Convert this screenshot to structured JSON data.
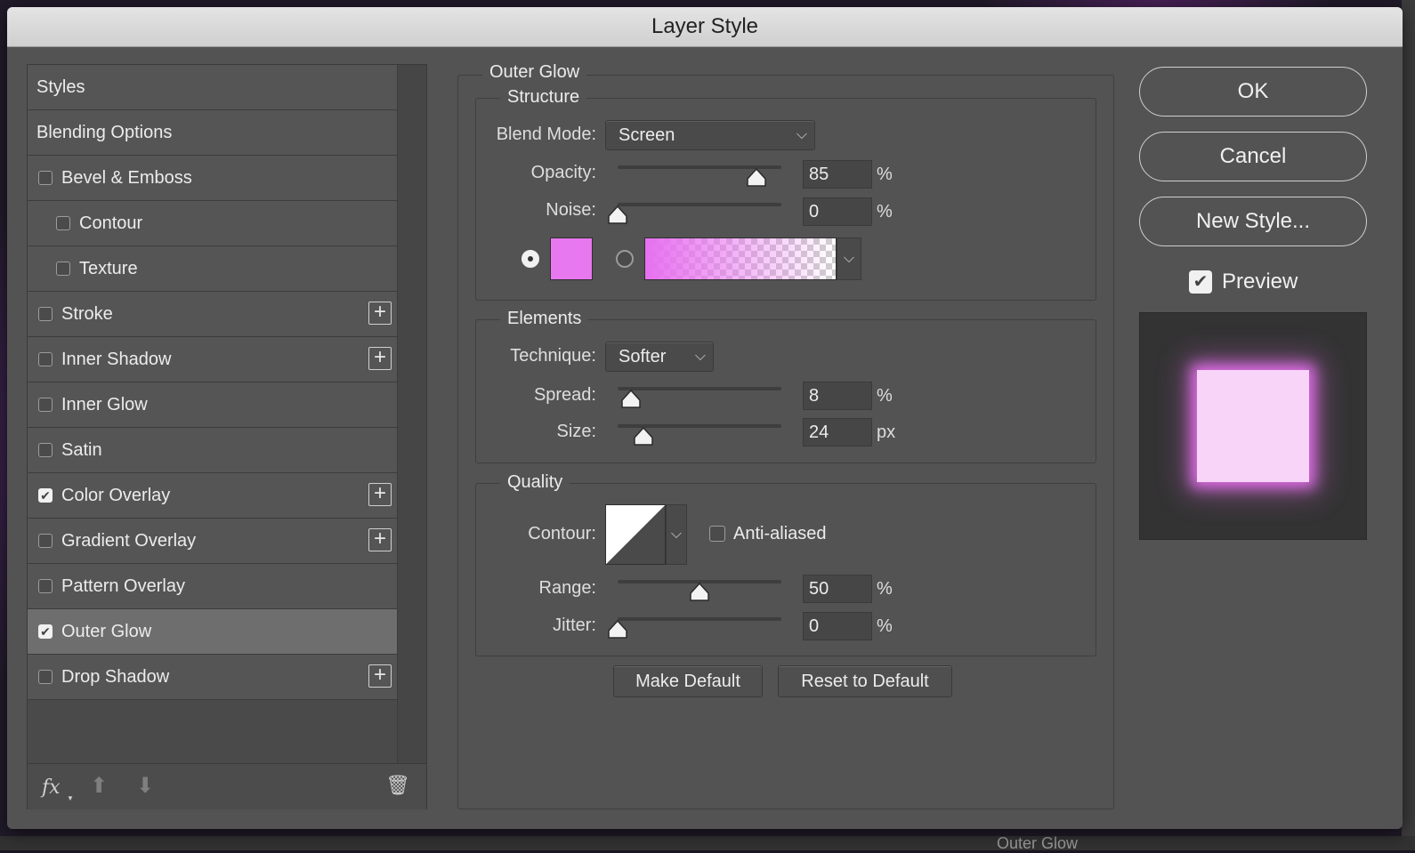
{
  "dialog": {
    "title": "Layer Style"
  },
  "styles_list": {
    "items": [
      {
        "label": "Styles",
        "checkbox": false,
        "checked": false,
        "sub": false,
        "plus": false,
        "selected": false
      },
      {
        "label": "Blending Options",
        "checkbox": false,
        "checked": false,
        "sub": false,
        "plus": false,
        "selected": false
      },
      {
        "label": "Bevel & Emboss",
        "checkbox": true,
        "checked": false,
        "sub": false,
        "plus": false,
        "selected": false
      },
      {
        "label": "Contour",
        "checkbox": true,
        "checked": false,
        "sub": true,
        "plus": false,
        "selected": false
      },
      {
        "label": "Texture",
        "checkbox": true,
        "checked": false,
        "sub": true,
        "plus": false,
        "selected": false
      },
      {
        "label": "Stroke",
        "checkbox": true,
        "checked": false,
        "sub": false,
        "plus": true,
        "selected": false
      },
      {
        "label": "Inner Shadow",
        "checkbox": true,
        "checked": false,
        "sub": false,
        "plus": true,
        "selected": false
      },
      {
        "label": "Inner Glow",
        "checkbox": true,
        "checked": false,
        "sub": false,
        "plus": false,
        "selected": false
      },
      {
        "label": "Satin",
        "checkbox": true,
        "checked": false,
        "sub": false,
        "plus": false,
        "selected": false
      },
      {
        "label": "Color Overlay",
        "checkbox": true,
        "checked": true,
        "sub": false,
        "plus": true,
        "selected": false
      },
      {
        "label": "Gradient Overlay",
        "checkbox": true,
        "checked": false,
        "sub": false,
        "plus": true,
        "selected": false
      },
      {
        "label": "Pattern Overlay",
        "checkbox": true,
        "checked": false,
        "sub": false,
        "plus": false,
        "selected": false
      },
      {
        "label": "Outer Glow",
        "checkbox": true,
        "checked": true,
        "sub": false,
        "plus": false,
        "selected": true
      },
      {
        "label": "Drop Shadow",
        "checkbox": true,
        "checked": false,
        "sub": false,
        "plus": true,
        "selected": false
      }
    ],
    "footer": {
      "fx_label": "fx"
    }
  },
  "outer_glow": {
    "title": "Outer Glow",
    "structure": {
      "legend": "Structure",
      "blend_mode_label": "Blend Mode:",
      "blend_mode_value": "Screen",
      "opacity_label": "Opacity:",
      "opacity_value": "85",
      "opacity_unit": "%",
      "opacity_fraction": 0.85,
      "noise_label": "Noise:",
      "noise_value": "0",
      "noise_unit": "%",
      "noise_fraction": 0.0,
      "solid_color": "#e878f0",
      "color_mode_selected": "solid"
    },
    "elements": {
      "legend": "Elements",
      "technique_label": "Technique:",
      "technique_value": "Softer",
      "spread_label": "Spread:",
      "spread_value": "8",
      "spread_unit": "%",
      "spread_fraction": 0.08,
      "size_label": "Size:",
      "size_value": "24",
      "size_unit": "px",
      "size_fraction": 0.16
    },
    "quality": {
      "legend": "Quality",
      "contour_label": "Contour:",
      "anti_aliased_label": "Anti-aliased",
      "anti_aliased_checked": false,
      "range_label": "Range:",
      "range_value": "50",
      "range_unit": "%",
      "range_fraction": 0.5,
      "jitter_label": "Jitter:",
      "jitter_value": "0",
      "jitter_unit": "%",
      "jitter_fraction": 0.0
    },
    "make_default_label": "Make Default",
    "reset_default_label": "Reset to Default"
  },
  "actions": {
    "ok_label": "OK",
    "cancel_label": "Cancel",
    "new_style_label": "New Style...",
    "preview_label": "Preview",
    "preview_checked": true
  },
  "background": {
    "layers_panel_text": "Outer Glow"
  }
}
